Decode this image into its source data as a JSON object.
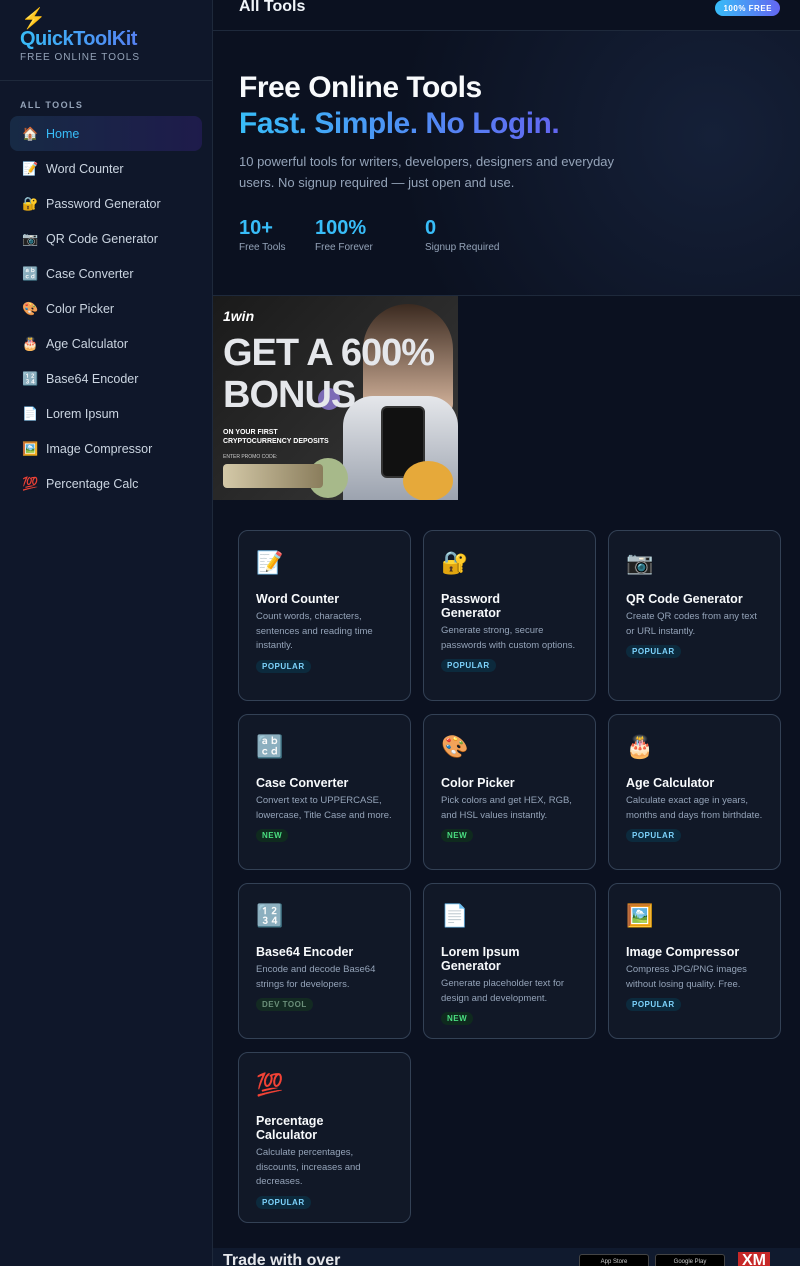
{
  "sidebar": {
    "logo": "QuickToolKit",
    "tagline": "FREE ONLINE TOOLS",
    "nav_title": "ALL TOOLS",
    "items": [
      {
        "label": "Home",
        "icon": "🏠"
      },
      {
        "label": "Word Counter",
        "icon": "📝"
      },
      {
        "label": "Password Generator",
        "icon": "🔐"
      },
      {
        "label": "QR Code Generator",
        "icon": "📷"
      },
      {
        "label": "Case Converter",
        "icon": "🔡"
      },
      {
        "label": "Color Picker",
        "icon": "🎨"
      },
      {
        "label": "Age Calculator",
        "icon": "🎂"
      },
      {
        "label": "Base64 Encoder",
        "icon": "🔢"
      },
      {
        "label": "Lorem Ipsum",
        "icon": "📄"
      },
      {
        "label": "Image Compressor",
        "icon": "🖼️"
      },
      {
        "label": "Percentage Calc",
        "icon": "💯"
      }
    ]
  },
  "topbar": {
    "title": "All Tools",
    "badge": "100% FREE"
  },
  "hero": {
    "title_line1": "Free Online Tools",
    "title_line2": "Fast. Simple. No Login.",
    "subtitle": "10 powerful tools for writers, developers, designers and everyday users. No signup required — just open and use.",
    "stats": [
      {
        "num": "10+",
        "label": "Free Tools"
      },
      {
        "num": "100%",
        "label": "Free Forever"
      },
      {
        "num": "0",
        "label": "Signup Required"
      }
    ]
  },
  "ad": {
    "brand": "1win",
    "headline_1": "GET A 600%",
    "headline_2": "BONUS",
    "subline": "ON YOUR FIRST CRYPTOCURRENCY DEPOSITS",
    "promo_label": "ENTER PROMO CODE:"
  },
  "cards": [
    {
      "icon": "📝",
      "title": "Word Counter",
      "desc": "Count words, characters, sentences and reading time instantly.",
      "badge": "POPULAR",
      "badge_type": "popular"
    },
    {
      "icon": "🔐",
      "title": "Password Generator",
      "desc": "Generate strong, secure passwords with custom options.",
      "badge": "POPULAR",
      "badge_type": "popular"
    },
    {
      "icon": "📷",
      "title": "QR Code Generator",
      "desc": "Create QR codes from any text or URL instantly.",
      "badge": "POPULAR",
      "badge_type": "popular"
    },
    {
      "icon": "🔡",
      "title": "Case Converter",
      "desc": "Convert text to UPPERCASE, lowercase, Title Case and more.",
      "badge": "NEW",
      "badge_type": "new"
    },
    {
      "icon": "🎨",
      "title": "Color Picker",
      "desc": "Pick colors and get HEX, RGB, and HSL values instantly.",
      "badge": "NEW",
      "badge_type": "new"
    },
    {
      "icon": "🎂",
      "title": "Age Calculator",
      "desc": "Calculate exact age in years, months and days from birthdate.",
      "badge": "POPULAR",
      "badge_type": "popular"
    },
    {
      "icon": "🔢",
      "title": "Base64 Encoder",
      "desc": "Encode and decode Base64 strings for developers.",
      "badge": "DEV TOOL",
      "badge_type": "dev"
    },
    {
      "icon": "📄",
      "title": "Lorem Ipsum Generator",
      "desc": "Generate placeholder text for design and development.",
      "badge": "NEW",
      "badge_type": "new"
    },
    {
      "icon": "🖼️",
      "title": "Image Compressor",
      "desc": "Compress JPG/PNG images without losing quality. Free.",
      "badge": "POPULAR",
      "badge_type": "popular"
    },
    {
      "icon": "💯",
      "title": "Percentage Calculator",
      "desc": "Calculate percentages, discounts, increases and decreases.",
      "badge": "POPULAR",
      "badge_type": "popular"
    }
  ],
  "bottom_ad": {
    "text": "Trade with over",
    "store_1": "App Store",
    "store_2": "Google Play",
    "brand": "XM"
  },
  "colors": {
    "background": "#0b1120",
    "sidebar": "#0f172a",
    "accent": "#38bdf8",
    "accent_2": "#6366f1",
    "card_border": "#334155"
  }
}
